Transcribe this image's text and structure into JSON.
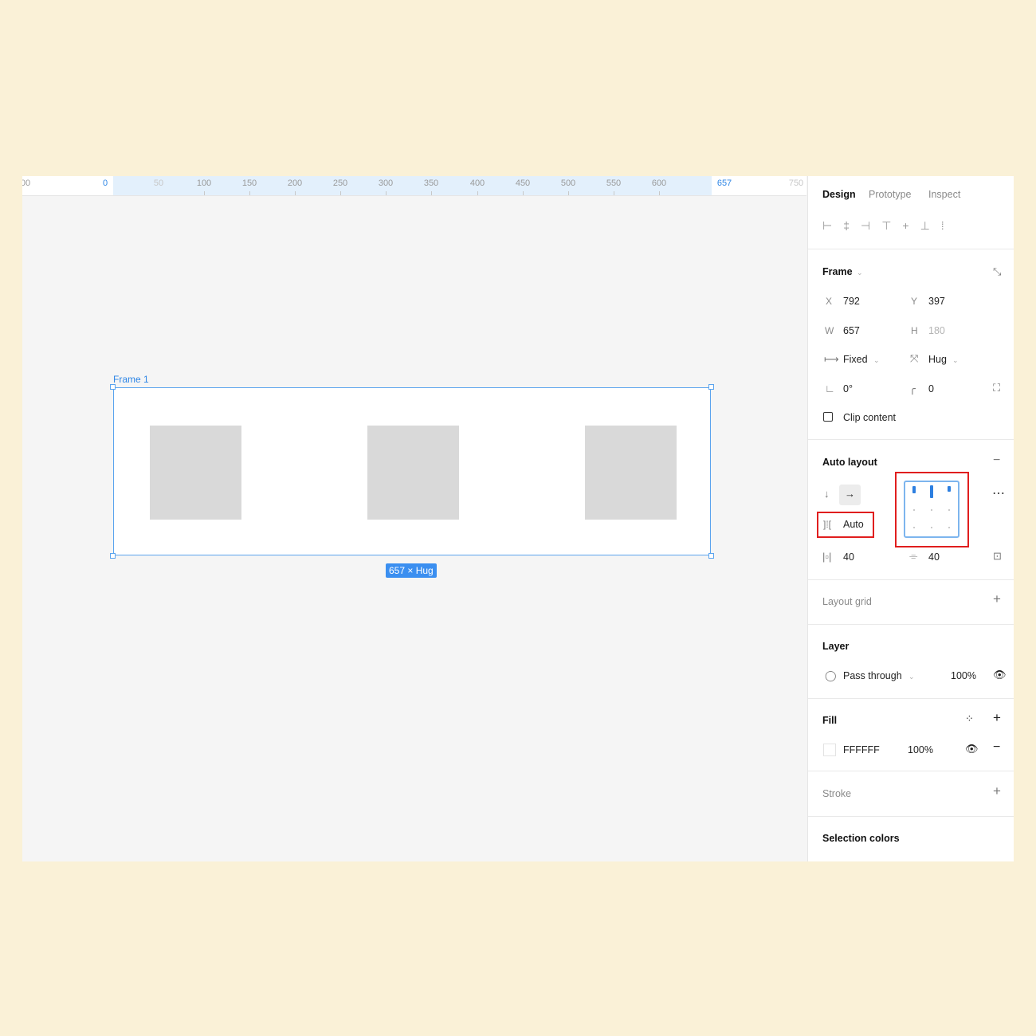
{
  "ruler": {
    "ticks": [
      "00",
      "0",
      "50",
      "100",
      "150",
      "200",
      "250",
      "300",
      "350",
      "400",
      "450",
      "500",
      "550",
      "600",
      "657",
      "750"
    ]
  },
  "canvas": {
    "frame_name": "Frame 1",
    "size_badge": "657 × Hug",
    "frame_fill": "#FFFFFF",
    "child_fill": "#D9D9D9",
    "selection_color": "#2E86E6"
  },
  "panel": {
    "tabs": [
      "Design",
      "Prototype",
      "Inspect"
    ],
    "alignment_icons": [
      "align-left-icon",
      "align-horizontal-center-icon",
      "align-right-icon",
      "align-top-icon",
      "align-vertical-center-icon",
      "align-bottom-icon",
      "distribute-icon"
    ],
    "frame": {
      "title": "Frame",
      "x_label": "X",
      "x": "792",
      "y_label": "Y",
      "y": "397",
      "w_label": "W",
      "w": "657",
      "h_label": "H",
      "h": "180",
      "width_mode": "Fixed",
      "height_mode": "Hug",
      "rotation": "0°",
      "radius": "0",
      "clip_content": "Clip content"
    },
    "auto_layout": {
      "title": "Auto layout",
      "spacing": "Auto",
      "padding_horizontal": "40",
      "padding_vertical": "40",
      "direction": "horizontal"
    },
    "layout_grid": {
      "title": "Layout grid"
    },
    "layer": {
      "title": "Layer",
      "blend_mode": "Pass through",
      "opacity": "100%"
    },
    "fill": {
      "title": "Fill",
      "hex": "FFFFFF",
      "opacity": "100%"
    },
    "stroke": {
      "title": "Stroke"
    },
    "selection_colors": {
      "title": "Selection colors"
    }
  }
}
